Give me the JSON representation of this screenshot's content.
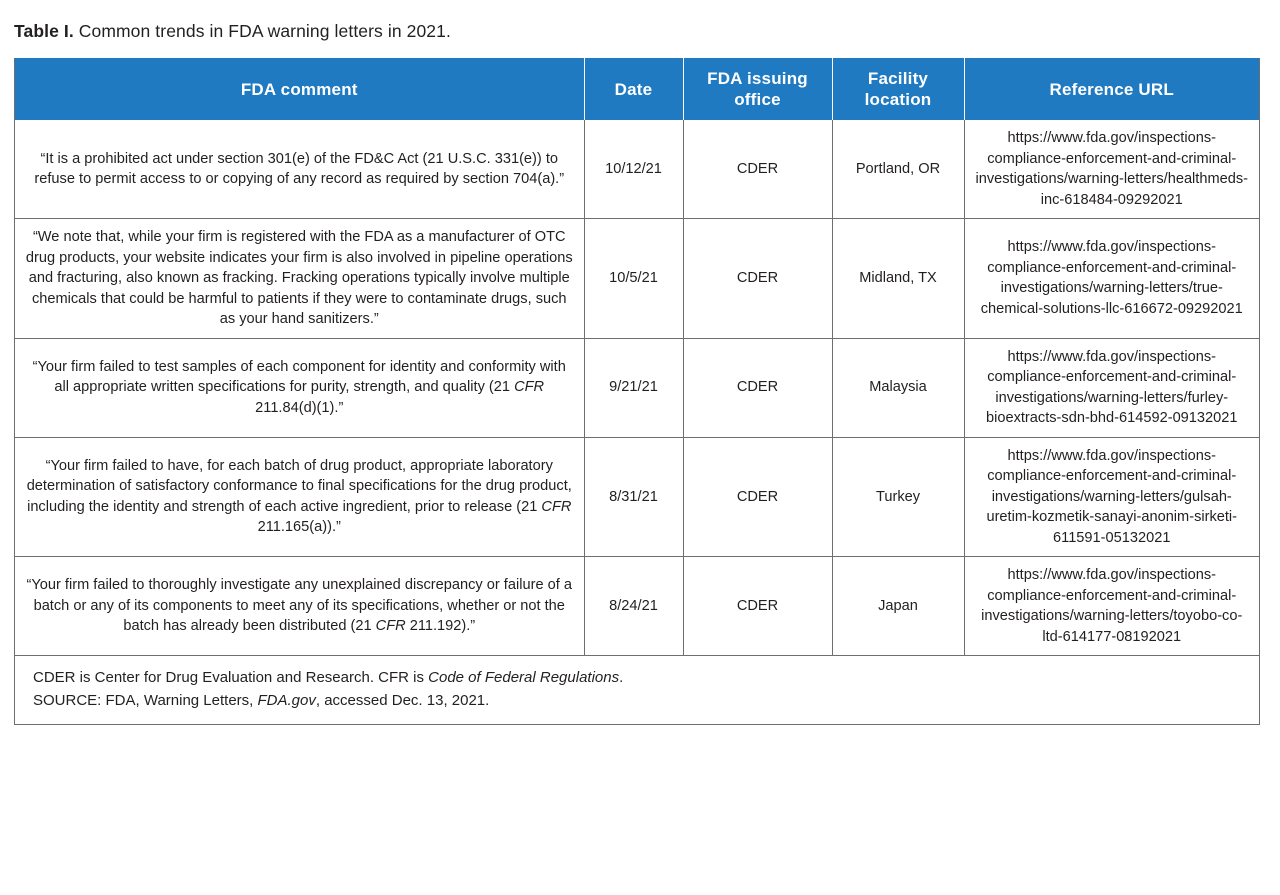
{
  "caption": {
    "label": "Table I.",
    "text": " Common trends in FDA warning letters in 2021."
  },
  "colors": {
    "header_background": "#1f7ac2",
    "header_text": "#ffffff",
    "border": "#6d6e71",
    "body_text": "#231f20"
  },
  "table": {
    "headers": [
      "FDA comment",
      "Date",
      "FDA issuing office",
      "Facility location",
      "Reference URL"
    ],
    "rows": [
      {
        "comment": "“It is a prohibited act under section 301(e) of the FD&C Act (21 U.S.C. 331(e)) to refuse to permit access to or copying of any record as required by section 704(a).”",
        "date": "10/12/21",
        "office": "CDER",
        "location": "Portland, OR",
        "url": "https://www.fda.gov/inspections-compliance-enforcement-and-criminal-investigations/warning-letters/healthmeds-inc-618484-09292021"
      },
      {
        "comment": "“We note that, while your firm is registered with the FDA as a manufacturer of OTC drug products, your website indicates your firm is also involved in pipeline operations and fracturing, also known as fracking. Fracking operations typically involve multiple chemicals that could be harmful to patients if they were to contaminate drugs, such as your hand sanitizers.”",
        "date": "10/5/21",
        "office": "CDER",
        "location": "Midland, TX",
        "url": "https://www.fda.gov/inspections-compliance-enforcement-and-criminal-investigations/warning-letters/true-chemical-solutions-llc-616672-09292021"
      },
      {
        "comment_pre": "“Your firm failed to test samples of each component for identity and conformity with all appropriate written specifications for purity, strength, and quality (21 ",
        "comment_italic": "CFR",
        "comment_post": " 211.84(d)(1).”",
        "comment": "“Your firm failed to test samples of each component for identity and conformity with all appropriate written specifications for purity, strength, and quality (21 CFR 211.84(d)(1).”",
        "date": "9/21/21",
        "office": "CDER",
        "location": "Malaysia",
        "url": "https://www.fda.gov/inspections-compliance-enforcement-and-criminal-investigations/warning-letters/furley-bioextracts-sdn-bhd-614592-09132021"
      },
      {
        "comment_pre": "“Your firm failed to have, for each batch of drug product, appropriate laboratory determination of satisfactory conformance to final specifications for the drug product, including the identity and strength of each active ingredient, prior to release (21 ",
        "comment_italic": "CFR",
        "comment_post": " 211.165(a)).”",
        "comment": "“Your firm failed to have, for each batch of drug product, appropriate laboratory determination of satisfactory conformance to final specifications for the drug product, including the identity and strength of each active ingredient, prior to release (21 CFR 211.165(a)).”",
        "date": "8/31/21",
        "office": "CDER",
        "location": "Turkey",
        "url": "https://www.fda.gov/inspections-compliance-enforcement-and-criminal-investigations/warning-letters/gulsah-uretim-kozmetik-sanayi-anonim-sirketi-611591-05132021"
      },
      {
        "comment_pre": "“Your firm failed to thoroughly investigate any unexplained discrepancy or failure of a batch or any of its components to meet any of its specifications, whether or not the batch has already been distributed (21 ",
        "comment_italic": "CFR",
        "comment_post": " 211.192).”",
        "comment": "“Your firm failed to thoroughly investigate any unexplained discrepancy or failure of a batch or any of its components to meet any of its specifications, whether or not the batch has already been distributed (21 CFR 211.192).”",
        "date": "8/24/21",
        "office": "CDER",
        "location": "Japan",
        "url": "https://www.fda.gov/inspections-compliance-enforcement-and-criminal-investigations/warning-letters/toyobo-co-ltd-614177-08192021"
      }
    ],
    "footnote": {
      "line1_pre": "CDER is Center for Drug Evaluation and Research. CFR is ",
      "line1_italic": "Code of Federal Regulations",
      "line1_post": ".",
      "line2_pre": "SOURCE: FDA, Warning Letters, ",
      "line2_italic": "FDA.gov",
      "line2_post": ", accessed Dec. 13, 2021."
    }
  }
}
